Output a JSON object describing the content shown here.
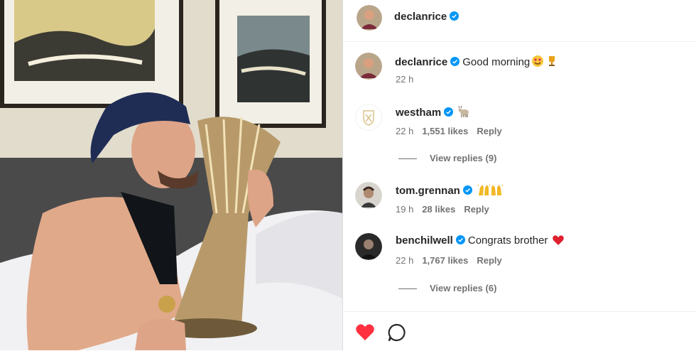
{
  "post": {
    "author": "declanrice"
  },
  "caption": {
    "username": "declanrice",
    "text": "Good morning",
    "time": "22 h"
  },
  "comments": [
    {
      "username": "westham",
      "text": "",
      "time": "22 h",
      "likes": "1,551 likes",
      "reply": "Reply",
      "view_replies": "View replies (9)"
    },
    {
      "username": "tom.grennan",
      "text": "",
      "time": "19 h",
      "likes": "28 likes",
      "reply": "Reply"
    },
    {
      "username": "benchilwell",
      "text": "Congrats brother",
      "time": "22 h",
      "likes": "1,767 likes",
      "reply": "Reply",
      "view_replies": "View replies (6)"
    }
  ],
  "icons": {
    "verified": "verified-badge-icon",
    "like": "heart-icon",
    "comment": "speech-bubble-icon"
  },
  "colors": {
    "verified": "#0095f6",
    "like": "#ff3040",
    "secondary_text": "#737373"
  }
}
